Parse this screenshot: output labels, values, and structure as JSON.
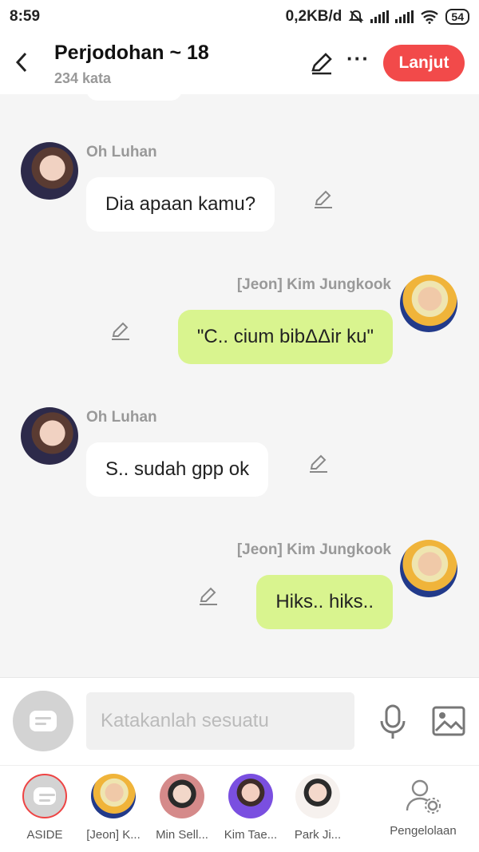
{
  "status_bar": {
    "time": "8:59",
    "net_speed": "0,2KB/d",
    "battery": "54"
  },
  "header": {
    "title": "Perjodohan ~ 18",
    "word_count": "234 kata",
    "next_label": "Lanjut"
  },
  "messages": [
    {
      "sender": "Oh Luhan",
      "text": "Dia apaan kamu?",
      "side": "left"
    },
    {
      "sender": "[Jeon] Kim Jungkook",
      "text": "\"C.. cium bibΔΔir ku\"",
      "side": "right"
    },
    {
      "sender": "Oh Luhan",
      "text": "S.. sudah gpp ok",
      "side": "left"
    },
    {
      "sender": "[Jeon] Kim Jungkook",
      "text": "Hiks.. hiks..",
      "side": "right"
    }
  ],
  "input": {
    "placeholder": "Katakanlah sesuatu"
  },
  "characters": [
    {
      "label": "ASIDE"
    },
    {
      "label": "[Jeon] K..."
    },
    {
      "label": "Min Sell..."
    },
    {
      "label": "Kim Tae..."
    },
    {
      "label": "Park Ji..."
    }
  ],
  "management": {
    "label": "Pengelolaan"
  },
  "colors": {
    "accent": "#f24a4a",
    "outgoing_bubble": "#d9f48f",
    "incoming_bubble": "#ffffff"
  }
}
